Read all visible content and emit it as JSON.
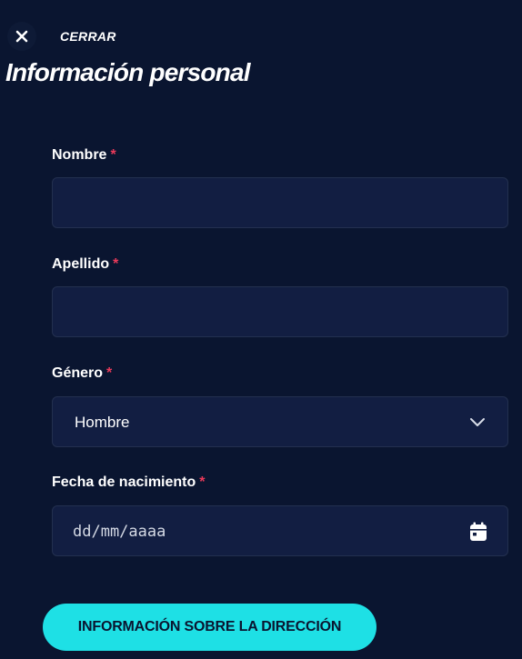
{
  "header": {
    "close_label": "CERRAR",
    "title": "Información personal"
  },
  "form": {
    "first_name": {
      "label": "Nombre",
      "required_mark": "*",
      "value": ""
    },
    "last_name": {
      "label": "Apellido",
      "required_mark": "*",
      "value": ""
    },
    "gender": {
      "label": "Género",
      "required_mark": "*",
      "selected": "Hombre"
    },
    "birth_date": {
      "label": "Fecha de nacimiento",
      "required_mark": "*",
      "placeholder": "dd/mm/aaaa"
    },
    "submit_label": "INFORMACIÓN SOBRE LA DIRECCIÓN"
  },
  "icons": {
    "close": "close-icon",
    "dropdown": "chevron-down-icon",
    "date": "calendar-icon"
  },
  "colors": {
    "background": "#0a1530",
    "input_background": "#121e42",
    "required": "#ea3a5a",
    "accent": "#1ee0e5"
  }
}
